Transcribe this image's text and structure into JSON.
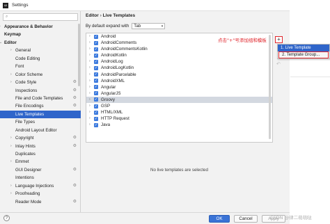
{
  "window": {
    "title": "Settings",
    "app_icon": "IJ"
  },
  "search": {
    "placeholder": ""
  },
  "sidebar": {
    "items": [
      {
        "label": "Appearance & Behavior",
        "bold": true,
        "arrow": "›",
        "indent": 0
      },
      {
        "label": "Keymap",
        "bold": true,
        "arrow": "",
        "indent": 0
      },
      {
        "label": "Editor",
        "bold": true,
        "arrow": "⌄",
        "indent": 0
      },
      {
        "label": "General",
        "arrow": "›",
        "indent": 1
      },
      {
        "label": "Code Editing",
        "arrow": "",
        "indent": 1
      },
      {
        "label": "Font",
        "arrow": "",
        "indent": 1
      },
      {
        "label": "Color Scheme",
        "arrow": "›",
        "indent": 1
      },
      {
        "label": "Code Style",
        "arrow": "›",
        "indent": 1,
        "gear": true
      },
      {
        "label": "Inspections",
        "arrow": "",
        "indent": 1,
        "gear": true
      },
      {
        "label": "File and Code Templates",
        "arrow": "",
        "indent": 1,
        "gear": true
      },
      {
        "label": "File Encodings",
        "arrow": "",
        "indent": 1,
        "gear": true
      },
      {
        "label": "Live Templates",
        "arrow": "",
        "indent": 1,
        "selected": true
      },
      {
        "label": "File Types",
        "arrow": "",
        "indent": 1
      },
      {
        "label": "Android Layout Editor",
        "arrow": "",
        "indent": 1
      },
      {
        "label": "Copyright",
        "arrow": "›",
        "indent": 1,
        "gear": true
      },
      {
        "label": "Inlay Hints",
        "arrow": "›",
        "indent": 1,
        "gear": true
      },
      {
        "label": "Duplicates",
        "arrow": "",
        "indent": 1
      },
      {
        "label": "Emmet",
        "arrow": "›",
        "indent": 1
      },
      {
        "label": "GUI Designer",
        "arrow": "",
        "indent": 1,
        "gear": true
      },
      {
        "label": "Intentions",
        "arrow": "",
        "indent": 1
      },
      {
        "label": "Language Injections",
        "arrow": "›",
        "indent": 1,
        "gear": true
      },
      {
        "label": "Proofreading",
        "arrow": "›",
        "indent": 1
      },
      {
        "label": "Reader Mode",
        "arrow": "",
        "indent": 1,
        "gear": true
      }
    ]
  },
  "panel": {
    "breadcrumb_parent": "Editor",
    "breadcrumb_sep": "›",
    "breadcrumb_current": "Live Templates",
    "expand_label": "By default expand with",
    "expand_value": "Tab",
    "empty_message": "No live templates are selected"
  },
  "templates": [
    {
      "label": "Android"
    },
    {
      "label": "AndroidComments"
    },
    {
      "label": "AndroidCommentsKotlin"
    },
    {
      "label": "AndroidKotlin"
    },
    {
      "label": "AndroidLog"
    },
    {
      "label": "AndroidLogKotlin"
    },
    {
      "label": "AndroidParcelable"
    },
    {
      "label": "AndroidXML"
    },
    {
      "label": "Angular"
    },
    {
      "label": "AngularJS"
    },
    {
      "label": "Groovy",
      "selected": true
    },
    {
      "label": "GSP"
    },
    {
      "label": "HTML/XML"
    },
    {
      "label": "HTTP Request"
    },
    {
      "label": "Java"
    }
  ],
  "toolbar": {
    "add_glyph": "+",
    "undo_glyph": "↶"
  },
  "popup": {
    "items": [
      {
        "label": "1. Live Template"
      },
      {
        "label": "2. Template Group..."
      }
    ]
  },
  "annotation": "点击\"+\"号添加组和模板",
  "footer": {
    "help": "?",
    "ok": "OK",
    "cancel": "Cancel",
    "apply": "Apply"
  },
  "watermark": "CSDN @律二萌萌哒",
  "colors": {
    "selection": "#2f65ca",
    "annotation": "#e0262c",
    "checkbox": "#3d7bde"
  }
}
